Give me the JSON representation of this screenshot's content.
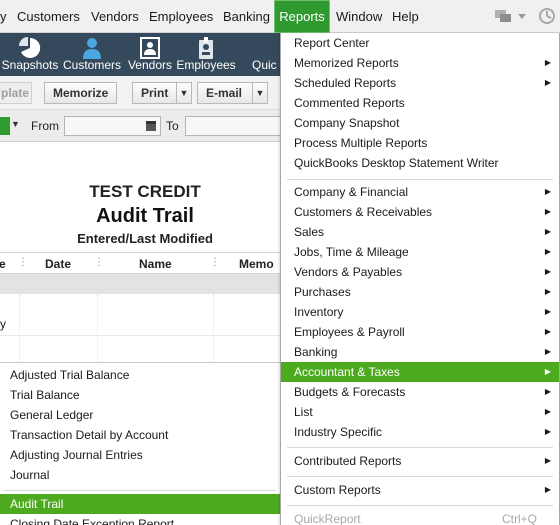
{
  "menubar": {
    "items": [
      "y",
      "Customers",
      "Vendors",
      "Employees",
      "Banking",
      "Reports",
      "Window",
      "Help"
    ],
    "active": "Reports"
  },
  "iconbar": {
    "items": [
      {
        "label": "Snapshots",
        "icon": "pie-chart-icon"
      },
      {
        "label": "Customers",
        "icon": "person-icon"
      },
      {
        "label": "Vendors",
        "icon": "vendor-icon"
      },
      {
        "label": "Employees",
        "icon": "employee-badge-icon"
      },
      {
        "label": "Quic",
        "icon": "quick-icon"
      }
    ]
  },
  "toolbar": {
    "template_label": "plate",
    "memorize_label": "Memorize",
    "print_label": "Print",
    "email_label": "E-mail"
  },
  "filter": {
    "from_label": "From",
    "to_label": "To"
  },
  "report": {
    "company": "TEST CREDIT",
    "title": "Audit Trail",
    "subtitle": "Entered/Last Modified",
    "columns": [
      "e",
      "Date",
      "Name",
      "Memo"
    ],
    "row_marker": "y"
  },
  "submenu": {
    "items": [
      "Adjusted Trial Balance",
      "Trial Balance",
      "General Ledger",
      "Transaction Detail by Account",
      "Adjusting Journal Entries",
      "Journal",
      "Audit Trail",
      "Closing Date Exception Report"
    ],
    "selected": "Audit Trail"
  },
  "reports_menu": {
    "group1": [
      {
        "label": "Report Center",
        "arrow": false
      },
      {
        "label": "Memorized Reports",
        "arrow": true
      },
      {
        "label": "Scheduled Reports",
        "arrow": true
      },
      {
        "label": "Commented Reports",
        "arrow": false
      },
      {
        "label": "Company Snapshot",
        "arrow": false
      },
      {
        "label": "Process Multiple Reports",
        "arrow": false
      },
      {
        "label": "QuickBooks Desktop Statement Writer",
        "arrow": false
      }
    ],
    "group2": [
      {
        "label": "Company & Financial",
        "arrow": true
      },
      {
        "label": "Customers & Receivables",
        "arrow": true
      },
      {
        "label": "Sales",
        "arrow": true
      },
      {
        "label": "Jobs, Time & Mileage",
        "arrow": true
      },
      {
        "label": "Vendors & Payables",
        "arrow": true
      },
      {
        "label": "Purchases",
        "arrow": true
      },
      {
        "label": "Inventory",
        "arrow": true
      },
      {
        "label": "Employees & Payroll",
        "arrow": true
      },
      {
        "label": "Banking",
        "arrow": true
      },
      {
        "label": "Accountant & Taxes",
        "arrow": true
      },
      {
        "label": "Budgets & Forecasts",
        "arrow": true
      },
      {
        "label": "List",
        "arrow": true
      },
      {
        "label": "Industry Specific",
        "arrow": true
      }
    ],
    "group3": [
      {
        "label": "Contributed Reports",
        "arrow": true
      }
    ],
    "group4": [
      {
        "label": "Custom Reports",
        "arrow": true
      }
    ],
    "group5": [
      {
        "label": "QuickReport",
        "shortcut": "Ctrl+Q"
      }
    ],
    "highlighted": "Accountant & Taxes"
  },
  "colors": {
    "menu_highlight": "#4daa1e",
    "active_menu": "#2f9a2f",
    "iconbar_bg": "#34495b"
  }
}
